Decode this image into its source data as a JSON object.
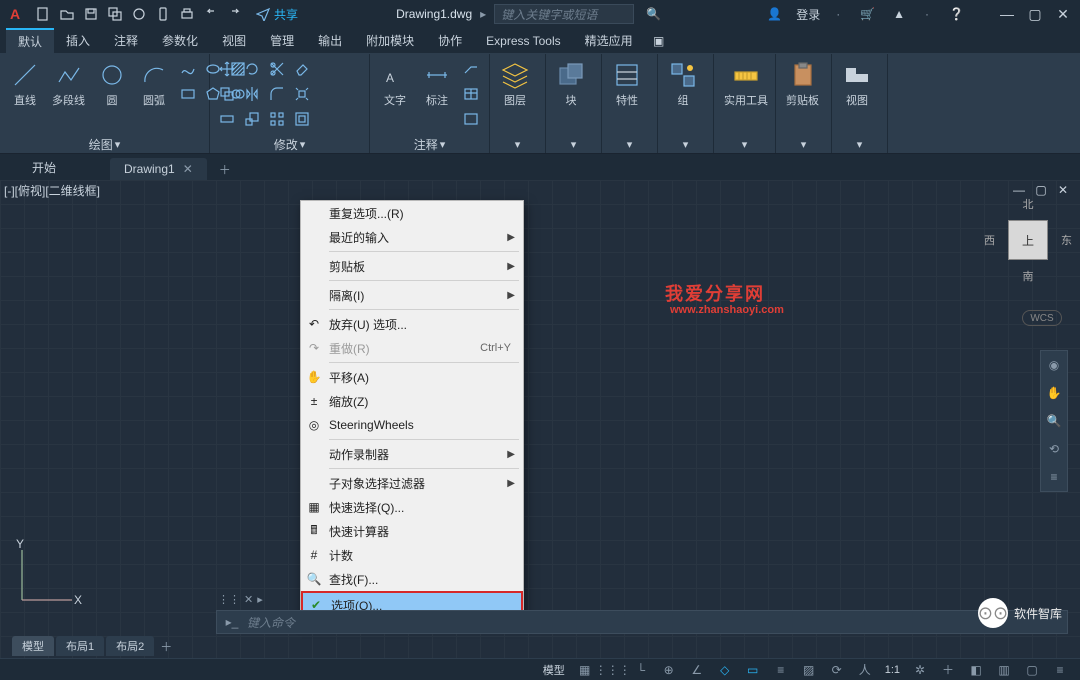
{
  "title": {
    "doc": "Drawing1.dwg"
  },
  "search": {
    "placeholder": "键入关键字或短语"
  },
  "share": "共享",
  "login": "登录",
  "tabs": [
    "默认",
    "插入",
    "注释",
    "参数化",
    "视图",
    "管理",
    "输出",
    "附加模块",
    "协作",
    "Express Tools",
    "精选应用"
  ],
  "ribbon": {
    "draw": {
      "title": "绘图",
      "line": "直线",
      "polyline": "多段线",
      "circle": "圆",
      "arc": "圆弧"
    },
    "modify": {
      "title": "修改"
    },
    "annotate": {
      "title": "注释",
      "text": "文字",
      "dim": "标注"
    },
    "layers": {
      "title": "图层"
    },
    "block": {
      "title": "块"
    },
    "props": {
      "title": "特性"
    },
    "group": {
      "title": "组"
    },
    "util": {
      "title": "实用工具"
    },
    "clip": {
      "title": "剪贴板"
    },
    "view": {
      "title": "视图"
    }
  },
  "docTabs": {
    "start": "开始",
    "drawing": "Drawing1"
  },
  "workTitle": "[-][俯视][二维线框]",
  "context": {
    "repeat": "重复选项...(R)",
    "recent": "最近的输入",
    "clipboard": "剪贴板",
    "isolate": "隔离(I)",
    "undo": "放弃(U) 选项...",
    "redo": "重做(R)",
    "redoKey": "Ctrl+Y",
    "pan": "平移(A)",
    "zoom": "缩放(Z)",
    "wheels": "SteeringWheels",
    "action": "动作录制器",
    "subfilter": "子对象选择过滤器",
    "qselect": "快速选择(Q)...",
    "qcalc": "快速计算器",
    "count": "计数",
    "find": "查找(F)...",
    "options": "选项(O)..."
  },
  "watermark": {
    "t1": "我爱分享网",
    "t2": "www.zhanshaoyi.com"
  },
  "viewcube": {
    "face": "上",
    "n": "北",
    "s": "南",
    "e": "东",
    "w": "西",
    "wcs": "WCS"
  },
  "cmd": {
    "placeholder": "键入命令"
  },
  "layout": {
    "model": "模型",
    "l1": "布局1",
    "l2": "布局2"
  },
  "status": {
    "model": "模型",
    "scale": "1:1"
  },
  "footer": "软件智库"
}
